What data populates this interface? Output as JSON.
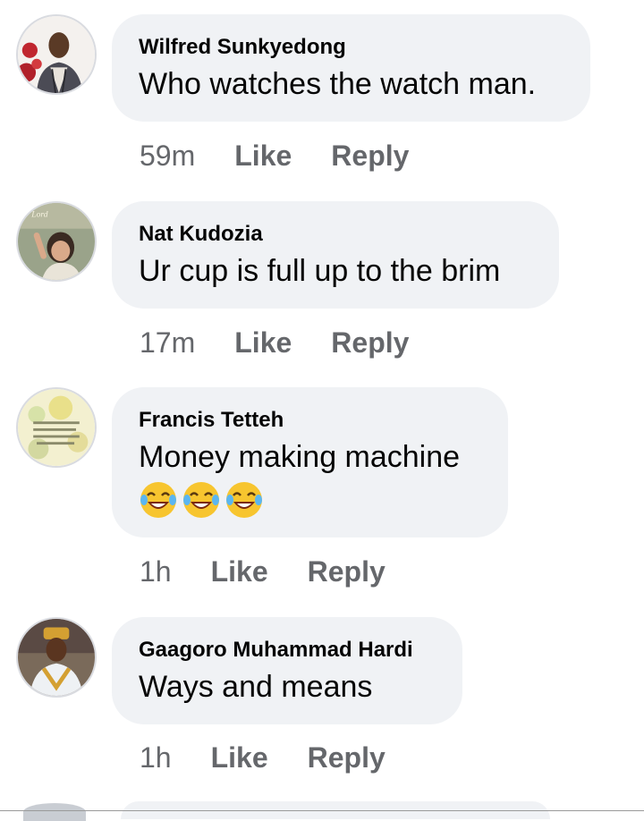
{
  "comments": [
    {
      "author": "Wilfred Sunkyedong",
      "text": "Who watches the watch man.",
      "time": "59m",
      "like_label": "Like",
      "reply_label": "Reply"
    },
    {
      "author": "Nat Kudozia",
      "text": "Ur cup is full up to the brim",
      "time": "17m",
      "like_label": "Like",
      "reply_label": "Reply"
    },
    {
      "author": "Francis Tetteh",
      "text": "Money making machine",
      "emojis": [
        "😂",
        "😂",
        "😂"
      ],
      "time": "1h",
      "like_label": "Like",
      "reply_label": "Reply"
    },
    {
      "author": "Gaagoro Muhammad Hardi",
      "text": "Ways and means",
      "time": "1h",
      "like_label": "Like",
      "reply_label": "Reply"
    }
  ],
  "colors": {
    "bubble_bg": "#f0f2f5",
    "meta_text": "#65676b",
    "author_text": "#050505"
  },
  "icons": [
    "avatar-photo",
    "face-with-tears-of-joy-emoji"
  ]
}
